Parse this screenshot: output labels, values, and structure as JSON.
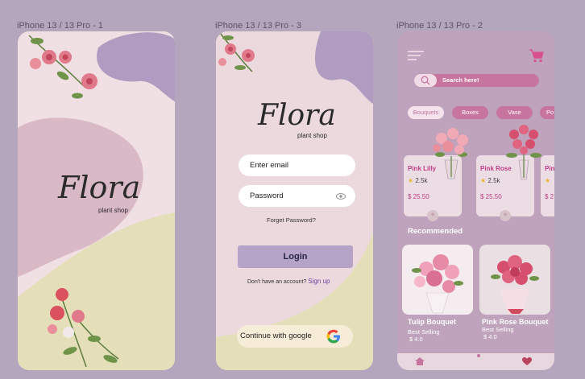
{
  "frames": [
    {
      "label": "iPhone 13 / 13 Pro - 1"
    },
    {
      "label": "iPhone 13 / 13 Pro - 3"
    },
    {
      "label": "iPhone 13 / 13 Pro - 2"
    }
  ],
  "splash": {
    "logo": "Flora",
    "tagline": "plant shop"
  },
  "login": {
    "logo": "Flora",
    "tagline": "plant shop",
    "email_placeholder": "Enter email",
    "password_placeholder": "Password",
    "forgot": "Forget Password?",
    "login_button": "Login",
    "no_account": "Don't have an account?",
    "signup": "Sign up",
    "google": "Continue with google"
  },
  "home": {
    "search_placeholder": "Search here!",
    "chips": [
      "Bouquets",
      "Boxes",
      "Vase",
      "Po"
    ],
    "products": [
      {
        "name": "Pink Lilly",
        "rating": "2.5k",
        "price": "$ 25.50"
      },
      {
        "name": "Pink Rose",
        "rating": "2.5k",
        "price": "$ 25.50"
      },
      {
        "name": "Pin",
        "rating": "",
        "price": "$ 2"
      }
    ],
    "recommended_title": "Recommended",
    "recommended": [
      {
        "name": "Tulip Bouquet",
        "sub": "Best Selling",
        "price": "$ 4.0"
      },
      {
        "name": "Pink Rose Bouquet",
        "sub": "Best Selling",
        "price": "$ 4.0"
      }
    ]
  },
  "colors": {
    "bg": "#b4a6bc",
    "pink_accent": "#c23d86",
    "lilac": "#b6a4c8",
    "cream": "#e8e0bc"
  }
}
